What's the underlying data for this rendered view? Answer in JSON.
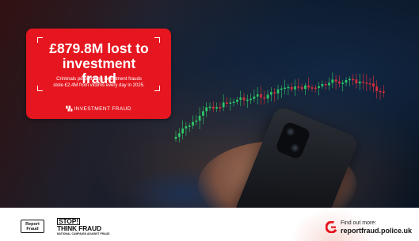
{
  "card": {
    "headline_line1": "£879.8M lost to",
    "headline_line2": "investment fraud",
    "subtext_line1": "Criminals perpetrating investment frauds",
    "subtext_line2": "stole £2.4M from victims every day in 2025.",
    "footer_label": "INVESTMENT FRAUD",
    "background_color": "#e5161f"
  },
  "logos": {
    "report_fraud_line1": "Report",
    "report_fraud_line2": "Fraud",
    "stop_line1": "STOP!",
    "stop_line2": "THINK FRAUD",
    "stop_tagline": "NATIONAL CAMPAIGN AGAINST FRAUD"
  },
  "cta": {
    "label": "Find out more:",
    "url": "reportfraud.police.uk",
    "icon": "report-fraud-logo-icon",
    "accent_color": "#e5161f"
  },
  "candles": {
    "up_color": "#2fd06a",
    "down_color": "#e8303a"
  }
}
